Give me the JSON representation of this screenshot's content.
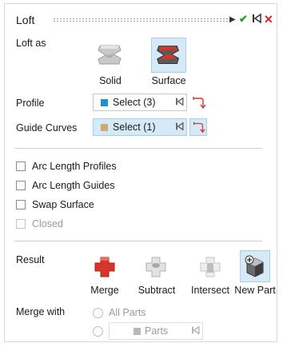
{
  "header": {
    "title": "Loft",
    "icons": [
      "play-icon",
      "check-icon",
      "rewind-icon",
      "close-icon"
    ]
  },
  "loft_as": {
    "label": "Loft as",
    "options": [
      {
        "label": "Solid",
        "selected": false
      },
      {
        "label": "Surface",
        "selected": true
      }
    ]
  },
  "profile": {
    "label": "Profile",
    "value": "Select (3)",
    "color": "#1e90d6"
  },
  "guide_curves": {
    "label": "Guide Curves",
    "value": "Select (1)",
    "color": "#d0a878"
  },
  "options": [
    {
      "label": "Arc Length Profiles",
      "checked": false,
      "enabled": true
    },
    {
      "label": "Arc Length Guides",
      "checked": false,
      "enabled": true
    },
    {
      "label": "Swap Surface",
      "checked": false,
      "enabled": true
    },
    {
      "label": "Closed",
      "checked": false,
      "enabled": false
    }
  ],
  "result": {
    "label": "Result",
    "options": [
      {
        "label": "Merge",
        "selected": false
      },
      {
        "label": "Subtract",
        "selected": false
      },
      {
        "label": "Intersect",
        "selected": false
      },
      {
        "label": "New Part",
        "selected": true
      }
    ]
  },
  "merge_with": {
    "label": "Merge with",
    "all_parts": "All Parts",
    "parts_value": "Parts"
  },
  "colors": {
    "accent_selected": "#d6e9f7",
    "check": "#2e9a2e",
    "close": "#d02020",
    "merge_red": "#d8352a"
  }
}
